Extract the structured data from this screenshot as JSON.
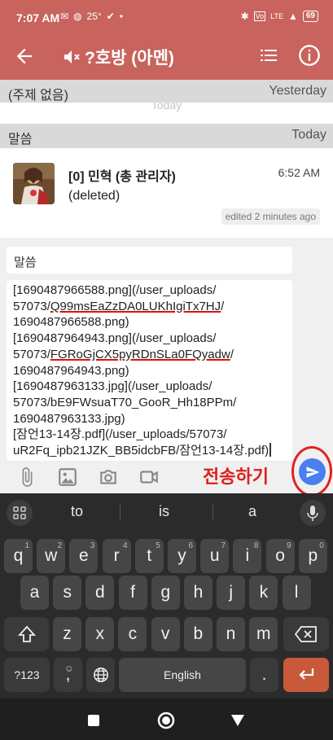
{
  "status_bar": {
    "time": "7:07 AM",
    "left_icons": [
      "email-icon",
      "messenger-icon",
      "check-icon",
      "more-dots-icon"
    ],
    "temperature": "25°",
    "network": "LTE",
    "battery": "69"
  },
  "app_bar": {
    "title": "?호방 (아멘)"
  },
  "topics": [
    {
      "name": "(주제 없음)",
      "when": "Yesterday"
    },
    {
      "name": "말씀",
      "when": "Today"
    }
  ],
  "today_divider": "Today",
  "message": {
    "sender": "[0] 민혁 (총 관리자)",
    "time": "6:52 AM",
    "body": "(deleted)",
    "edited": "edited 2 minutes ago"
  },
  "compose": {
    "topic": "말씀",
    "lines": [
      {
        "pre": "[1690487966588.png](/user_uploads/",
        "ul": "",
        "post": ""
      },
      {
        "pre": "57073/",
        "ul": "Q99msEaZzDA0LUKhIgiTx7HJ",
        "post": "/"
      },
      {
        "pre": "1690487966588.png)",
        "ul": "",
        "post": ""
      },
      {
        "pre": "[1690487964943.png](/user_uploads/",
        "ul": "",
        "post": ""
      },
      {
        "pre": "57073/",
        "ul": "FGRoGjCX5pyRDnSLa0FQyadw",
        "post": "/"
      },
      {
        "pre": "1690487964943.png)",
        "ul": "",
        "post": ""
      },
      {
        "pre": "[1690487963133.jpg](/user_uploads/",
        "ul": "",
        "post": ""
      },
      {
        "pre": "57073/bE9FWsuaT70_GooR_Hh18PPm/",
        "ul": "",
        "post": ""
      },
      {
        "pre": "1690487963133.jpg)",
        "ul": "",
        "post": ""
      },
      {
        "pre": "[잠언13-14장.pdf](/user_uploads/57073/",
        "ul": "",
        "post": ""
      },
      {
        "pre": "uR2Fq_ipb21JZK_BB5idcbFB/잠언13-14장.pdf)",
        "ul": "",
        "post": ""
      }
    ],
    "send_label": "전송하기"
  },
  "toolbar_icons": [
    "attach-icon",
    "image-icon",
    "camera-icon",
    "video-icon"
  ],
  "keyboard": {
    "suggestions": [
      "to",
      "is",
      "a"
    ],
    "row1": [
      "q",
      "w",
      "e",
      "r",
      "t",
      "y",
      "u",
      "i",
      "o",
      "p"
    ],
    "row1_hints": [
      "1",
      "2",
      "3",
      "4",
      "5",
      "6",
      "7",
      "8",
      "9",
      "0"
    ],
    "row2": [
      "a",
      "s",
      "d",
      "f",
      "g",
      "h",
      "j",
      "k",
      "l"
    ],
    "row3": [
      "z",
      "x",
      "c",
      "v",
      "b",
      "n",
      "m"
    ],
    "symbols_key": "?123",
    "comma_key": ",",
    "space_label": "English",
    "period_key": "."
  },
  "colors": {
    "header": "#c8645d",
    "send_button": "#4a7ff0",
    "annotation_red": "#e01d1d",
    "enter_key": "#c85a3a"
  }
}
